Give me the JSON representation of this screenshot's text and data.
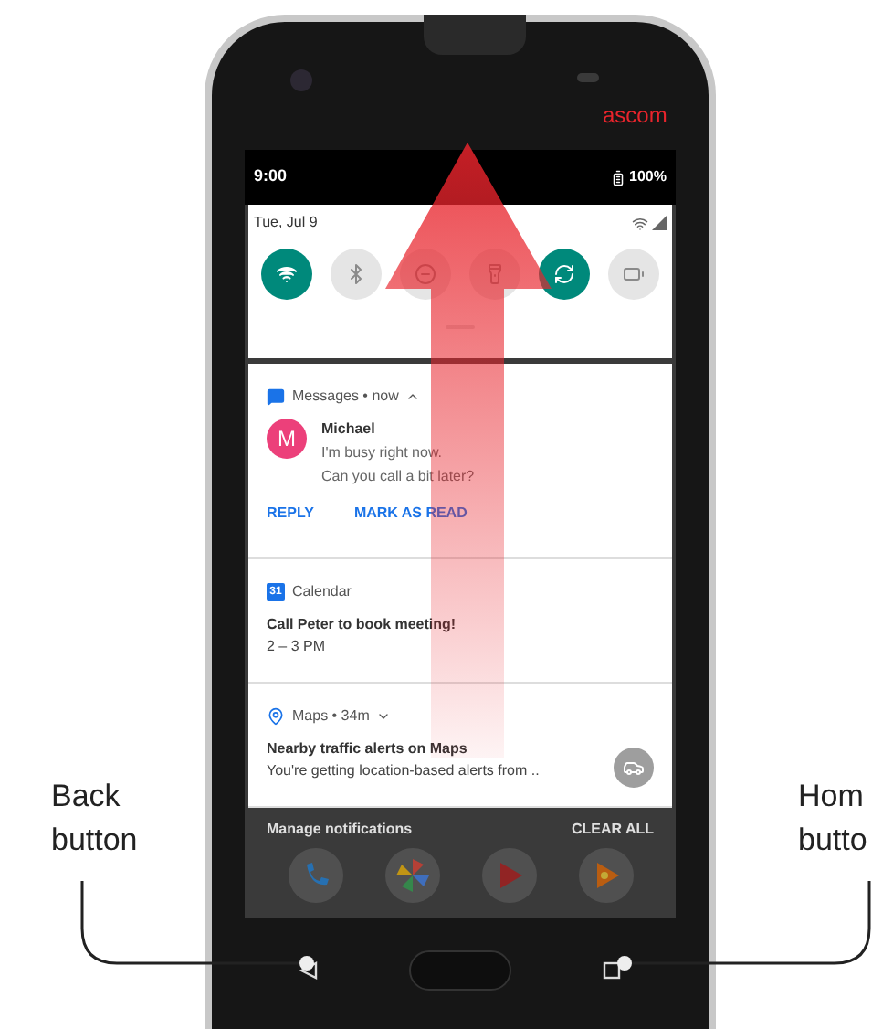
{
  "device": {
    "brand": "ascom"
  },
  "status_bar": {
    "time": "9:00",
    "battery": "100%"
  },
  "quick_settings": {
    "date": "Tue, Jul 9",
    "tiles": [
      {
        "kind": "wifi",
        "on": true
      },
      {
        "kind": "bluetooth",
        "on": false
      },
      {
        "kind": "dnd",
        "on": false
      },
      {
        "kind": "flashlight",
        "on": false
      },
      {
        "kind": "rotate",
        "on": true
      },
      {
        "kind": "battery",
        "on": false
      }
    ]
  },
  "notifications": [
    {
      "kind": "message",
      "header": "Messages • now",
      "expanded": true,
      "sender": "Michael",
      "avatar": "M",
      "lines": [
        "I'm busy right now.",
        "Can you call a bit later?"
      ],
      "actions": [
        "REPLY",
        "MARK AS READ"
      ]
    },
    {
      "kind": "event",
      "header": "Calendar",
      "badge": "31",
      "title": "Call Peter to book meeting!",
      "detail": "2 – 3 PM"
    },
    {
      "kind": "alert",
      "header": "Maps • 34m",
      "expanded": false,
      "title": "Nearby traffic alerts on Maps",
      "detail": "You're getting location-based alerts from .."
    }
  ],
  "footer": {
    "manage": "Manage notifications",
    "clear": "CLEAR ALL"
  },
  "callouts": [
    {
      "lines": [
        "Back",
        "button"
      ]
    },
    {
      "lines": [
        "Hom",
        "butto"
      ]
    }
  ]
}
